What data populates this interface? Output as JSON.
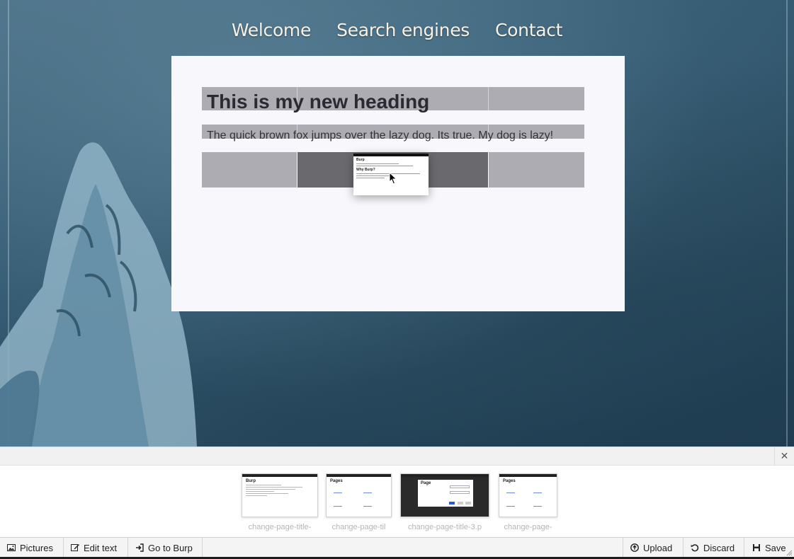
{
  "nav": {
    "items": [
      "Welcome",
      "Search engines",
      "Contact"
    ]
  },
  "content": {
    "heading": "This is my new heading",
    "body": "The quick brown fox jumps over the lazy dog. Its true. My dog is lazy!"
  },
  "drag_preview": {
    "title": "Burp",
    "subtitle": "Why Burp?"
  },
  "drawer": {
    "close_icon": "close-icon",
    "thumbnails": [
      {
        "label": "change-page-title-",
        "title": "Burp"
      },
      {
        "label": "change-page-til",
        "title": "Pages"
      },
      {
        "label": "change-page-title-3.p",
        "title": "Page"
      },
      {
        "label": "change-page-",
        "title": "Pages"
      }
    ]
  },
  "toolbar": {
    "pictures_label": "Pictures",
    "edit_text_label": "Edit text",
    "go_to_burp_label": "Go to Burp",
    "upload_label": "Upload",
    "discard_label": "Discard",
    "save_label": "Save"
  },
  "icons": {
    "pictures": "image-icon",
    "edit_text": "edit-icon",
    "go_to_burp": "sign-in-icon",
    "upload": "upload-icon",
    "discard": "undo-icon",
    "save": "floppy-disk-icon"
  },
  "colors": {
    "nav_text": "#f6f1e4",
    "background": "#345a72",
    "panel": "#f7f7fc",
    "grid_block": "#adacb2",
    "dark_block": "#6a6a6e"
  }
}
